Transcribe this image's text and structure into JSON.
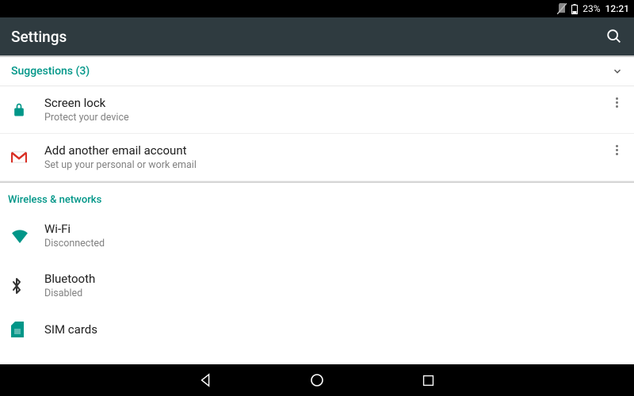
{
  "statusbar": {
    "battery_pct": "23%",
    "clock": "12:21"
  },
  "appbar": {
    "title": "Settings"
  },
  "suggestions": {
    "header": "Suggestions (3)",
    "items": [
      {
        "title": "Screen lock",
        "subtitle": "Protect your device",
        "icon": "lock-icon"
      },
      {
        "title": "Add another email account",
        "subtitle": "Set up your personal or work email",
        "icon": "gmail-icon"
      }
    ]
  },
  "sections": {
    "wireless": {
      "title": "Wireless & networks",
      "items": [
        {
          "title": "Wi-Fi",
          "subtitle": "Disconnected",
          "icon": "wifi-icon"
        },
        {
          "title": "Bluetooth",
          "subtitle": "Disabled",
          "icon": "bluetooth-icon"
        },
        {
          "title": "SIM cards",
          "subtitle": "",
          "icon": "sim-icon"
        }
      ]
    }
  },
  "colors": {
    "accent": "#009688",
    "appbar": "#2f3b40",
    "gmail_red": "#d93025"
  }
}
